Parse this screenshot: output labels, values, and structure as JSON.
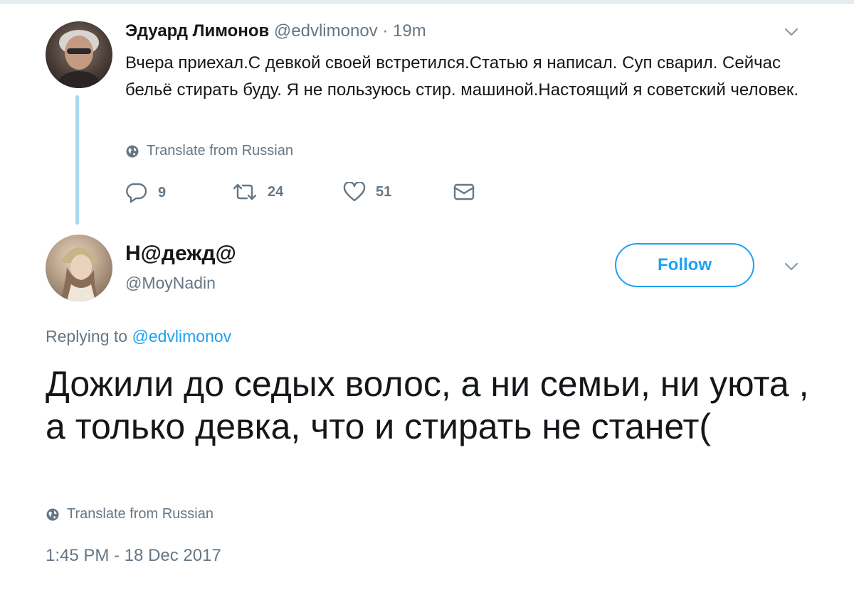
{
  "tweet1": {
    "author_name": "Эдуард Лимонов",
    "handle": "@edvlimonov",
    "separator": "·",
    "time": "19m",
    "text": "Вчера приехал.С девкой своей встретился.Статью я написал. Суп сварил. Сейчас бельё стирать буду. Я не пользуюсь стир. машиной.Настоящий я советский человек.",
    "translate_label": "Translate from Russian",
    "actions": {
      "replies": "9",
      "retweets": "24",
      "likes": "51"
    }
  },
  "tweet2": {
    "author_name": "Н@дежд@",
    "handle": "@MoyNadin",
    "follow_label": "Follow",
    "replying_prefix": "Replying to",
    "replying_handle": "@edvlimonov",
    "text": "Дожили до седых волос, а ни семьи, ни уюта , а только девка, что и стирать не станет(",
    "translate_label": "Translate from Russian",
    "timestamp": "1:45 PM - 18 Dec 2017"
  },
  "colors": {
    "accent": "#1da1f2",
    "muted": "#657786",
    "text": "#14171a",
    "thread_line": "#a7d9f1"
  },
  "icons": [
    "chevron-down-icon",
    "globe-icon",
    "reply-icon",
    "retweet-icon",
    "heart-icon",
    "envelope-icon"
  ]
}
